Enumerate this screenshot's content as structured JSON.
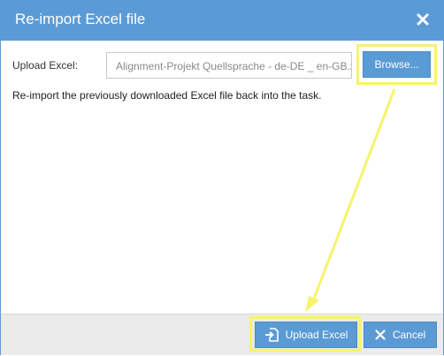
{
  "dialog": {
    "title": "Re-import Excel file",
    "close_icon": "close-icon"
  },
  "form": {
    "upload_label": "Upload Excel:",
    "file_value": "Alignment-Projekt Quellsprache - de-DE _ en-GB.xlsx",
    "browse_label": "Browse...",
    "description": "Re-import the previously downloaded Excel file back into the task."
  },
  "footer": {
    "upload_label": "Upload Excel",
    "upload_icon": "upload-file-icon",
    "cancel_label": "Cancel",
    "cancel_icon": "close-icon"
  },
  "colors": {
    "accent": "#5b9bd5",
    "highlight": "#f6f36c",
    "footer_bg": "#ebebeb"
  }
}
